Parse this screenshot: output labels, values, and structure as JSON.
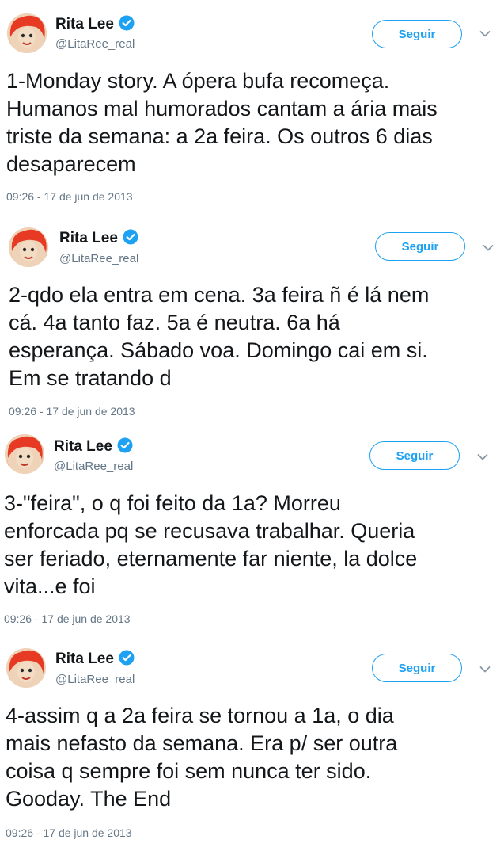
{
  "tweets": [
    {
      "name": "Rita Lee",
      "handle": "@LitaRee_real",
      "follow_label": "Seguir",
      "text": "1-Monday story.   A ópera bufa recomeça.\nHumanos mal humorados cantam a ária mais\ntriste da semana: a 2a feira. Os outros 6 dias\ndesaparecem",
      "timestamp": "09:26 - 17 de jun de 2013"
    },
    {
      "name": "Rita Lee",
      "handle": "@LitaRee_real",
      "follow_label": "Seguir",
      "text": "2-qdo ela entra em cena. 3a feira ñ é lá nem\ncá. 4a tanto faz. 5a é neutra. 6a há\nesperança. Sábado voa. Domingo cai em si.\nEm se tratando d",
      "timestamp": "09:26 - 17 de jun de 2013"
    },
    {
      "name": "Rita Lee",
      "handle": "@LitaRee_real",
      "follow_label": "Seguir",
      "text": "3-\"feira\", o q foi feito da 1a? Morreu\nenforcada pq se recusava trabalhar. Queria\nser feriado, eternamente far niente, la dolce\nvita...e foi",
      "timestamp": "09:26 - 17 de jun de 2013"
    },
    {
      "name": "Rita Lee",
      "handle": "@LitaRee_real",
      "follow_label": "Seguir",
      "text": "4-assim q a 2a feira se tornou a 1a, o dia\nmais nefasto da semana. Era p/ ser outra\ncoisa q sempre foi sem nunca ter sido.\nGooday. The End",
      "timestamp": "09:26 - 17 de jun de 2013"
    }
  ],
  "colors": {
    "accent": "#1da1f2",
    "secondary_text": "#657786",
    "primary_text": "#14171a"
  },
  "icons": {
    "verified": "verified-badge-icon",
    "more": "chevron-down-icon",
    "avatar": "avatar"
  }
}
